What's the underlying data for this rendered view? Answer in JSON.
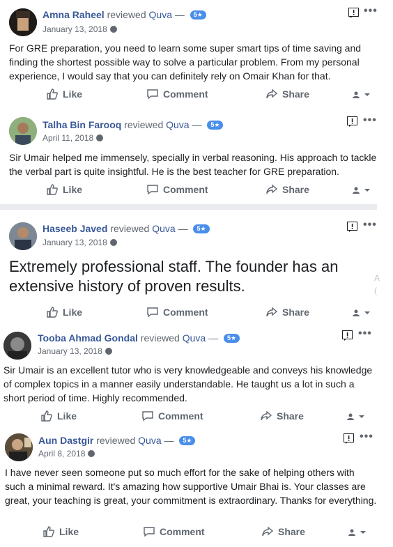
{
  "actions": {
    "like": "Like",
    "comment": "Comment",
    "share": "Share"
  },
  "reviews": [
    {
      "name": "Amna Raheel",
      "reviewed": "reviewed",
      "page": "Quva",
      "dash": "—",
      "rating": "5★",
      "date": "January 13, 2018",
      "text": "For GRE preparation, you need to learn some super smart tips of time saving and finding the shortest possible way to solve a particular problem. From my personal experience, I would say that you can definitely rely on Omair Khan for that."
    },
    {
      "name": "Talha Bin Farooq",
      "reviewed": "reviewed",
      "page": "Quva",
      "dash": "—",
      "rating": "5★",
      "date": "April 11, 2018",
      "text": "Sir Umair helped me immensely, specially in verbal reasoning. His approach to tackle the verbal part is quite insightful. He is the best teacher for GRE preparation."
    },
    {
      "name": "Haseeb Javed",
      "reviewed": "reviewed",
      "page": "Quva",
      "dash": "—",
      "rating": "5★",
      "date": "January 13, 2018",
      "text": "Extremely professional staff. The founder has an extensive history of proven results."
    },
    {
      "name": "Tooba Ahmad Gondal",
      "reviewed": "reviewed",
      "page": "Quva",
      "dash": "—",
      "rating": "5★",
      "date": "January 13, 2018",
      "text": "Sir Umair is an excellent tutor who is very knowledgeable and conveys his knowledge of complex topics in a manner easily understandable. He taught us a lot in such a short period of time. Highly recommended."
    },
    {
      "name": "Aun Dastgir",
      "reviewed": "reviewed",
      "page": "Quva",
      "dash": "—",
      "rating": "5★",
      "date": "April 8, 2018",
      "text": "I have never seen someone put so much effort for the sake of helping others with such a minimal reward. It's amazing how supportive Umair Bhai is. Your classes are great, your teaching is great, your commitment is extraordinary. Thanks for everything."
    }
  ],
  "edge_chars": [
    "A",
    "("
  ],
  "colors": {
    "link": "#385898",
    "meta": "#606770",
    "badge": "#4a8eeb",
    "separator": "#e9ebee"
  }
}
